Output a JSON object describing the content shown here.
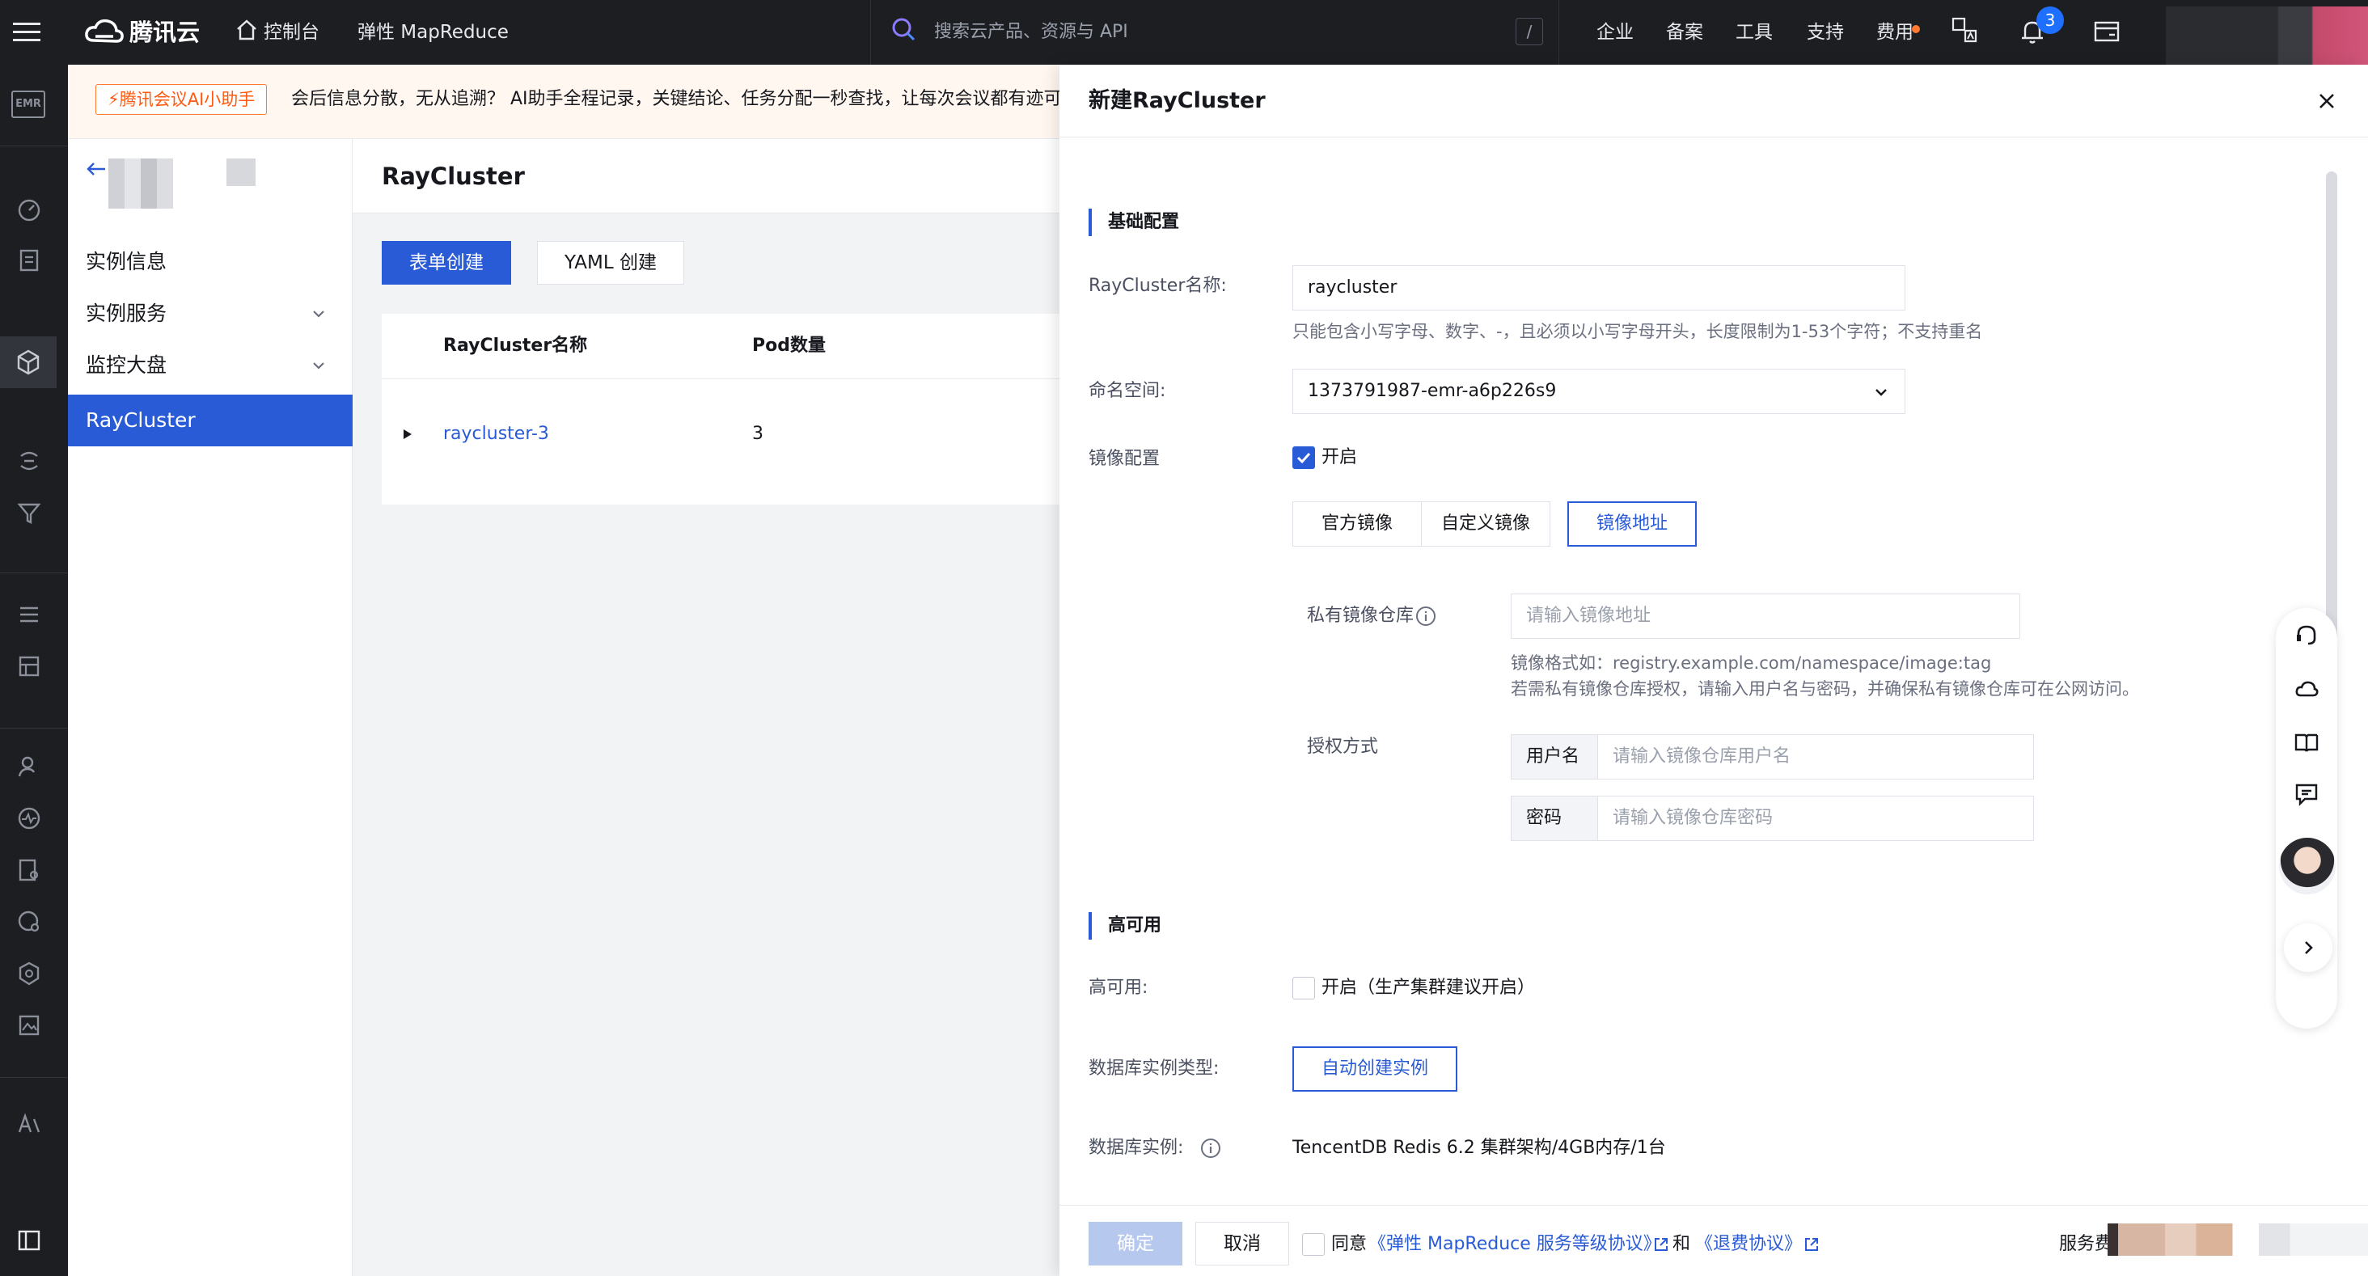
{
  "topbar": {
    "brand": "腾讯云",
    "console": "控制台",
    "product": "弹性 MapReduce",
    "search_placeholder": "搜索云产品、资源与 API",
    "search_shortcut": "/",
    "nav": [
      "企业",
      "备案",
      "工具",
      "支持",
      "费用"
    ],
    "notification_count": "3"
  },
  "rail": {
    "logo": "EMR"
  },
  "notice": {
    "tag": "⚡腾讯会议AI小助手",
    "text": "会后信息分散，无从追溯？ AI助手全程记录，关键结论、任务分配一秒查找，让每次会议都有迹可循"
  },
  "sidebar": {
    "items": [
      {
        "label": "实例信息",
        "expandable": false
      },
      {
        "label": "实例服务",
        "expandable": true
      },
      {
        "label": "监控大盘",
        "expandable": true
      },
      {
        "label": "RayCluster",
        "expandable": false,
        "active": true
      }
    ]
  },
  "page": {
    "title": "RayCluster",
    "btn_form": "表单创建",
    "btn_yaml": "YAML 创建",
    "table": {
      "columns": [
        "RayCluster名称",
        "Pod数量"
      ],
      "rows": [
        {
          "name": "raycluster-3",
          "pods": "3"
        }
      ]
    }
  },
  "drawer": {
    "title": "新建RayCluster",
    "basic_section": "基础配置",
    "name_label": "RayCluster名称:",
    "name_value": "raycluster",
    "name_hint": "只能包含小写字母、数字、-，且必须以小写字母开头，长度限制为1-53个字符；不支持重名",
    "namespace_label": "命名空间:",
    "namespace_value": "1373791987-emr-a6p226s9",
    "image_label": "镜像配置",
    "image_enable": "开启",
    "image_tabs": [
      "官方镜像",
      "自定义镜像",
      "镜像地址"
    ],
    "image_tab_active": 2,
    "private_repo_label": "私有镜像仓库",
    "private_repo_placeholder": "请输入镜像地址",
    "image_format_hint": "镜像格式如：registry.example.com/namespace/image:tag",
    "image_auth_hint": "若需私有镜像仓库授权，请输入用户名与密码，并确保私有镜像仓库可在公网访问。",
    "auth_label": "授权方式",
    "username_addon": "用户名",
    "username_placeholder": "请输入镜像仓库用户名",
    "password_addon": "密码",
    "password_placeholder": "请输入镜像仓库密码",
    "ha_section": "高可用",
    "ha_label": "高可用:",
    "ha_option": "开启（生产集群建议开启）",
    "db_type_label": "数据库实例类型:",
    "db_type_value": "自动创建实例",
    "db_instance_label": "数据库实例:",
    "db_instance_value": "TencentDB Redis 6.2 集群架构/4GB内存/1台",
    "footer": {
      "confirm": "确定",
      "cancel": "取消",
      "agree": "同意",
      "sla_link": "《弹性 MapReduce 服务等级协议》",
      "and": "和",
      "refund_link": "《退费协议》",
      "fee_label": "服务费"
    }
  },
  "colors": {
    "topbar_bg": "#1c1e22",
    "primary": "#2a5bd7",
    "notice_accent": "#ff7a2f"
  }
}
